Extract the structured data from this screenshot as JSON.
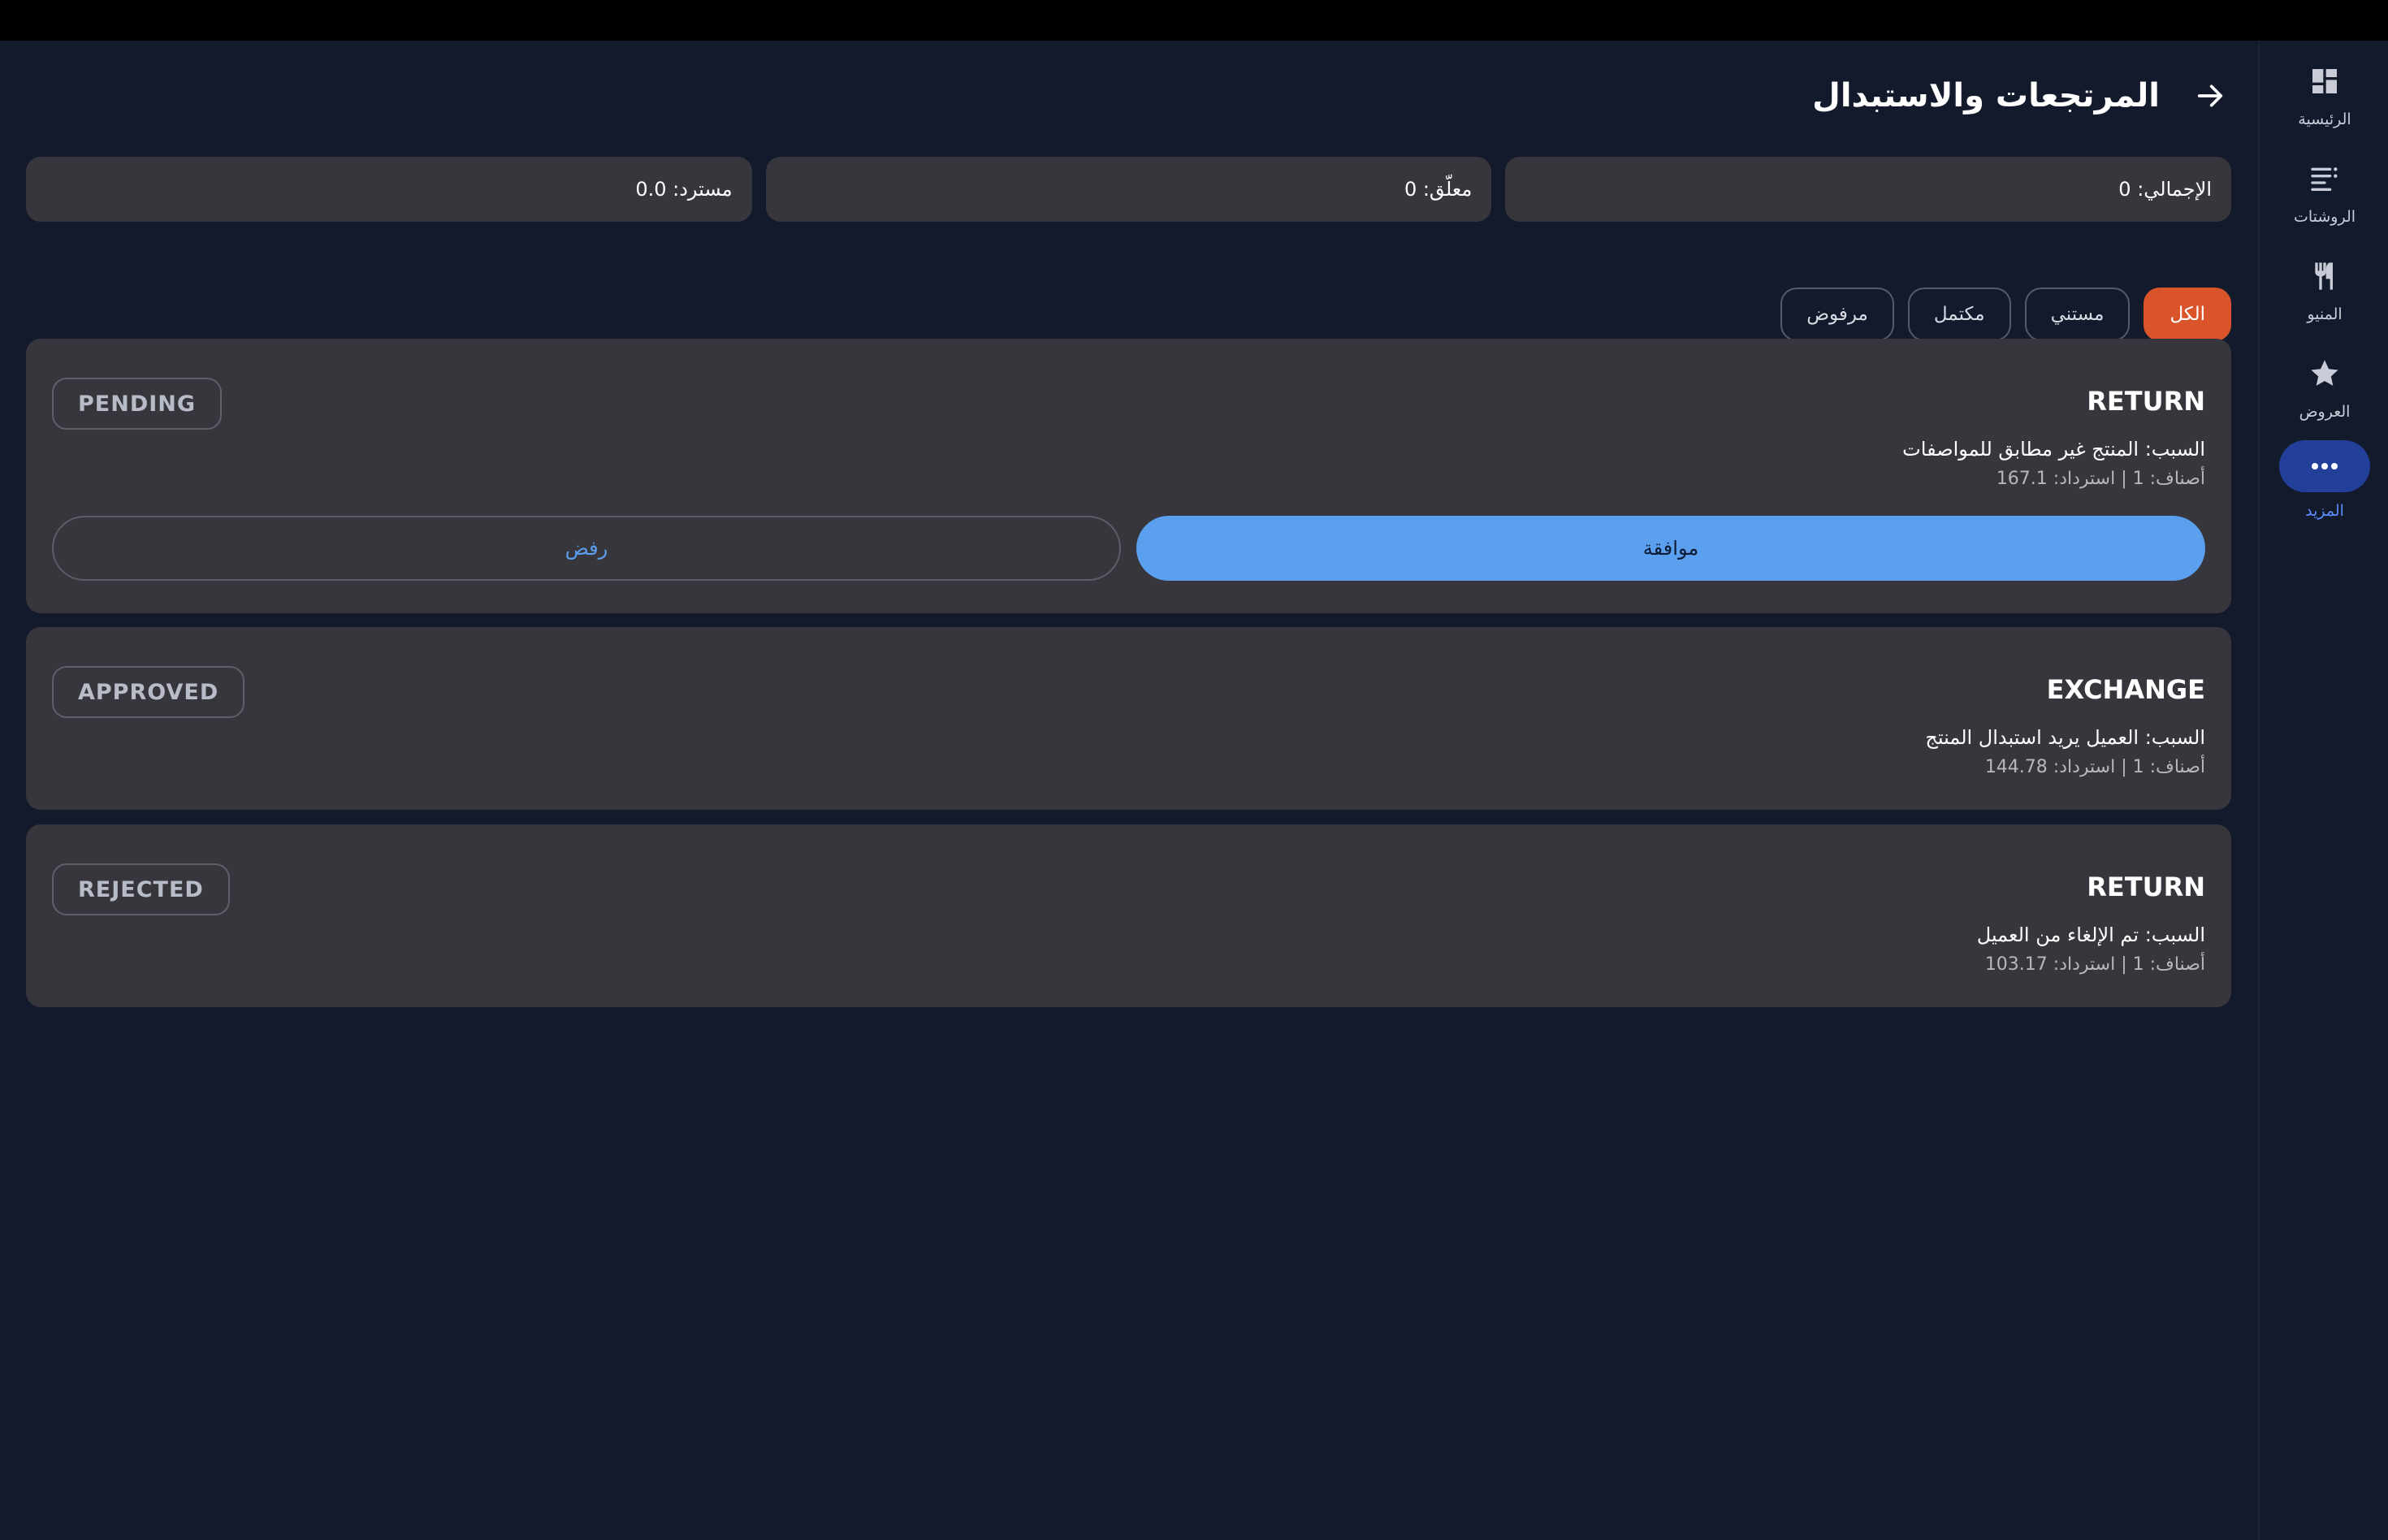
{
  "page": {
    "title": "المرتجعات والاستبدال",
    "back_icon": "arrow-right-icon"
  },
  "stats": {
    "total": "الإجمالي: 0",
    "pending": "معلّق: 0",
    "refunded": "مسترد: 0.0"
  },
  "filters": {
    "all": "الكل",
    "pending": "مستني",
    "completed": "مكتمل",
    "rejected": "مرفوض",
    "selected": "الكل"
  },
  "requests": [
    {
      "type": "RETURN",
      "reason": "السبب: المنتج غير مطابق للمواصفات",
      "meta": "أصناف: 1 | استرداد: 167.1",
      "status": "PENDING",
      "approve_label": "موافقة",
      "reject_label": "رفض"
    },
    {
      "type": "EXCHANGE",
      "reason": "السبب: العميل يريد استبدال المنتج",
      "meta": "أصناف: 1 | استرداد: 144.78",
      "status": "APPROVED"
    },
    {
      "type": "RETURN",
      "reason": "السبب: تم الإلغاء من العميل",
      "meta": "أصناف: 1 | استرداد: 103.17",
      "status": "REJECTED"
    }
  ],
  "nav": {
    "items": [
      {
        "label": "الرئيسية",
        "icon": "dashboard-icon"
      },
      {
        "label": "الروشتات",
        "icon": "list-icon"
      },
      {
        "label": "المنيو",
        "icon": "restaurant-menu-icon"
      },
      {
        "label": "العروض",
        "icon": "star-icon"
      },
      {
        "label": "المزيد",
        "icon": "more-horizontal-icon",
        "active": true
      }
    ]
  },
  "colors": {
    "background": "#131a2c",
    "card": "#38363d",
    "accent_orange": "#d9542b",
    "accent_blue": "#5aa0ef",
    "nav_active": "#223f9a"
  }
}
